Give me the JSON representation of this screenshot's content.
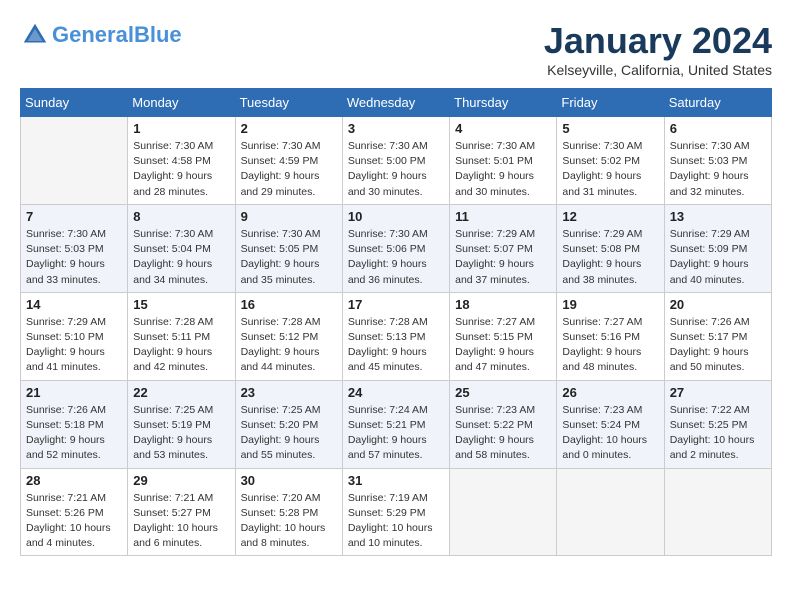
{
  "header": {
    "logo_line1": "General",
    "logo_line2": "Blue",
    "month_year": "January 2024",
    "location": "Kelseyville, California, United States"
  },
  "weekdays": [
    "Sunday",
    "Monday",
    "Tuesday",
    "Wednesday",
    "Thursday",
    "Friday",
    "Saturday"
  ],
  "weeks": [
    [
      {
        "day": "",
        "empty": true
      },
      {
        "day": "1",
        "sunrise": "Sunrise: 7:30 AM",
        "sunset": "Sunset: 4:58 PM",
        "daylight": "Daylight: 9 hours and 28 minutes."
      },
      {
        "day": "2",
        "sunrise": "Sunrise: 7:30 AM",
        "sunset": "Sunset: 4:59 PM",
        "daylight": "Daylight: 9 hours and 29 minutes."
      },
      {
        "day": "3",
        "sunrise": "Sunrise: 7:30 AM",
        "sunset": "Sunset: 5:00 PM",
        "daylight": "Daylight: 9 hours and 30 minutes."
      },
      {
        "day": "4",
        "sunrise": "Sunrise: 7:30 AM",
        "sunset": "Sunset: 5:01 PM",
        "daylight": "Daylight: 9 hours and 30 minutes."
      },
      {
        "day": "5",
        "sunrise": "Sunrise: 7:30 AM",
        "sunset": "Sunset: 5:02 PM",
        "daylight": "Daylight: 9 hours and 31 minutes."
      },
      {
        "day": "6",
        "sunrise": "Sunrise: 7:30 AM",
        "sunset": "Sunset: 5:03 PM",
        "daylight": "Daylight: 9 hours and 32 minutes."
      }
    ],
    [
      {
        "day": "7",
        "sunrise": "Sunrise: 7:30 AM",
        "sunset": "Sunset: 5:03 PM",
        "daylight": "Daylight: 9 hours and 33 minutes."
      },
      {
        "day": "8",
        "sunrise": "Sunrise: 7:30 AM",
        "sunset": "Sunset: 5:04 PM",
        "daylight": "Daylight: 9 hours and 34 minutes."
      },
      {
        "day": "9",
        "sunrise": "Sunrise: 7:30 AM",
        "sunset": "Sunset: 5:05 PM",
        "daylight": "Daylight: 9 hours and 35 minutes."
      },
      {
        "day": "10",
        "sunrise": "Sunrise: 7:30 AM",
        "sunset": "Sunset: 5:06 PM",
        "daylight": "Daylight: 9 hours and 36 minutes."
      },
      {
        "day": "11",
        "sunrise": "Sunrise: 7:29 AM",
        "sunset": "Sunset: 5:07 PM",
        "daylight": "Daylight: 9 hours and 37 minutes."
      },
      {
        "day": "12",
        "sunrise": "Sunrise: 7:29 AM",
        "sunset": "Sunset: 5:08 PM",
        "daylight": "Daylight: 9 hours and 38 minutes."
      },
      {
        "day": "13",
        "sunrise": "Sunrise: 7:29 AM",
        "sunset": "Sunset: 5:09 PM",
        "daylight": "Daylight: 9 hours and 40 minutes."
      }
    ],
    [
      {
        "day": "14",
        "sunrise": "Sunrise: 7:29 AM",
        "sunset": "Sunset: 5:10 PM",
        "daylight": "Daylight: 9 hours and 41 minutes."
      },
      {
        "day": "15",
        "sunrise": "Sunrise: 7:28 AM",
        "sunset": "Sunset: 5:11 PM",
        "daylight": "Daylight: 9 hours and 42 minutes."
      },
      {
        "day": "16",
        "sunrise": "Sunrise: 7:28 AM",
        "sunset": "Sunset: 5:12 PM",
        "daylight": "Daylight: 9 hours and 44 minutes."
      },
      {
        "day": "17",
        "sunrise": "Sunrise: 7:28 AM",
        "sunset": "Sunset: 5:13 PM",
        "daylight": "Daylight: 9 hours and 45 minutes."
      },
      {
        "day": "18",
        "sunrise": "Sunrise: 7:27 AM",
        "sunset": "Sunset: 5:15 PM",
        "daylight": "Daylight: 9 hours and 47 minutes."
      },
      {
        "day": "19",
        "sunrise": "Sunrise: 7:27 AM",
        "sunset": "Sunset: 5:16 PM",
        "daylight": "Daylight: 9 hours and 48 minutes."
      },
      {
        "day": "20",
        "sunrise": "Sunrise: 7:26 AM",
        "sunset": "Sunset: 5:17 PM",
        "daylight": "Daylight: 9 hours and 50 minutes."
      }
    ],
    [
      {
        "day": "21",
        "sunrise": "Sunrise: 7:26 AM",
        "sunset": "Sunset: 5:18 PM",
        "daylight": "Daylight: 9 hours and 52 minutes."
      },
      {
        "day": "22",
        "sunrise": "Sunrise: 7:25 AM",
        "sunset": "Sunset: 5:19 PM",
        "daylight": "Daylight: 9 hours and 53 minutes."
      },
      {
        "day": "23",
        "sunrise": "Sunrise: 7:25 AM",
        "sunset": "Sunset: 5:20 PM",
        "daylight": "Daylight: 9 hours and 55 minutes."
      },
      {
        "day": "24",
        "sunrise": "Sunrise: 7:24 AM",
        "sunset": "Sunset: 5:21 PM",
        "daylight": "Daylight: 9 hours and 57 minutes."
      },
      {
        "day": "25",
        "sunrise": "Sunrise: 7:23 AM",
        "sunset": "Sunset: 5:22 PM",
        "daylight": "Daylight: 9 hours and 58 minutes."
      },
      {
        "day": "26",
        "sunrise": "Sunrise: 7:23 AM",
        "sunset": "Sunset: 5:24 PM",
        "daylight": "Daylight: 10 hours and 0 minutes."
      },
      {
        "day": "27",
        "sunrise": "Sunrise: 7:22 AM",
        "sunset": "Sunset: 5:25 PM",
        "daylight": "Daylight: 10 hours and 2 minutes."
      }
    ],
    [
      {
        "day": "28",
        "sunrise": "Sunrise: 7:21 AM",
        "sunset": "Sunset: 5:26 PM",
        "daylight": "Daylight: 10 hours and 4 minutes."
      },
      {
        "day": "29",
        "sunrise": "Sunrise: 7:21 AM",
        "sunset": "Sunset: 5:27 PM",
        "daylight": "Daylight: 10 hours and 6 minutes."
      },
      {
        "day": "30",
        "sunrise": "Sunrise: 7:20 AM",
        "sunset": "Sunset: 5:28 PM",
        "daylight": "Daylight: 10 hours and 8 minutes."
      },
      {
        "day": "31",
        "sunrise": "Sunrise: 7:19 AM",
        "sunset": "Sunset: 5:29 PM",
        "daylight": "Daylight: 10 hours and 10 minutes."
      },
      {
        "day": "",
        "empty": true
      },
      {
        "day": "",
        "empty": true
      },
      {
        "day": "",
        "empty": true
      }
    ]
  ]
}
